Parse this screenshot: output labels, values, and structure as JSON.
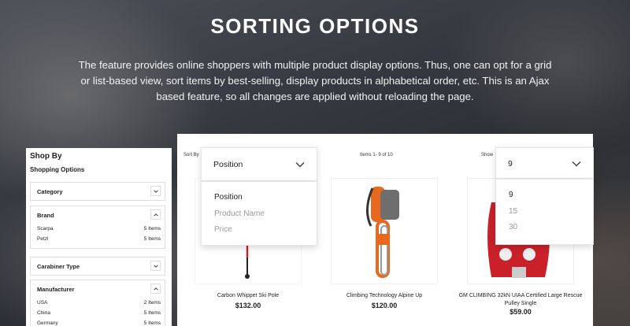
{
  "hero": {
    "title": "SORTING OPTIONS",
    "description": "The feature provides online shoppers with multiple product display options. Thus, one can opt for a grid or list-based view, sort items by best-selling, display products in alphabetical order, etc. This is an Ajax based feature, so all changes are applied without reloading the page."
  },
  "sidebar": {
    "title": "Shop By",
    "subtitle": "Shopping Options",
    "filters": [
      {
        "label": "Category",
        "expanded": false,
        "items": []
      },
      {
        "label": "Brand",
        "expanded": true,
        "items": [
          {
            "name": "Scarpa",
            "count": "5 Items"
          },
          {
            "name": "Petzl",
            "count": "5 Items"
          }
        ]
      },
      {
        "label": "Carabiner Type",
        "expanded": false,
        "items": []
      },
      {
        "label": "Manufacturer",
        "expanded": true,
        "items": [
          {
            "name": "USA",
            "count": "2 Items"
          },
          {
            "name": "China",
            "count": "5 Items"
          },
          {
            "name": "Germany",
            "count": "5 Items"
          }
        ]
      }
    ]
  },
  "toolbar": {
    "sort_label": "Sort By",
    "items_info": "Items 1- 9 of 10",
    "show_label": "Show"
  },
  "sort_dropdown": {
    "selected": "Position",
    "options": [
      "Position",
      "Product Name",
      "Price"
    ]
  },
  "show_dropdown": {
    "selected": "9",
    "options": [
      "9",
      "15",
      "30"
    ]
  },
  "products": [
    {
      "name": "Carbon Whippet Ski Pole",
      "price": "$132.00"
    },
    {
      "name": "Climbing Technology Alpine Up",
      "price": "$120.00"
    },
    {
      "name": "GM CLIMBING 32kN UIAA Certified Large Rescue Pulley Single",
      "price": "$59.00"
    }
  ],
  "icons": {
    "chevron_down": "chevron-down-icon",
    "chevron_up": "chevron-up-icon"
  },
  "colors": {
    "text_dark": "#222222",
    "text_muted": "#999999",
    "product_orange": "#e8681e",
    "pulley_red": "#c9202a"
  }
}
